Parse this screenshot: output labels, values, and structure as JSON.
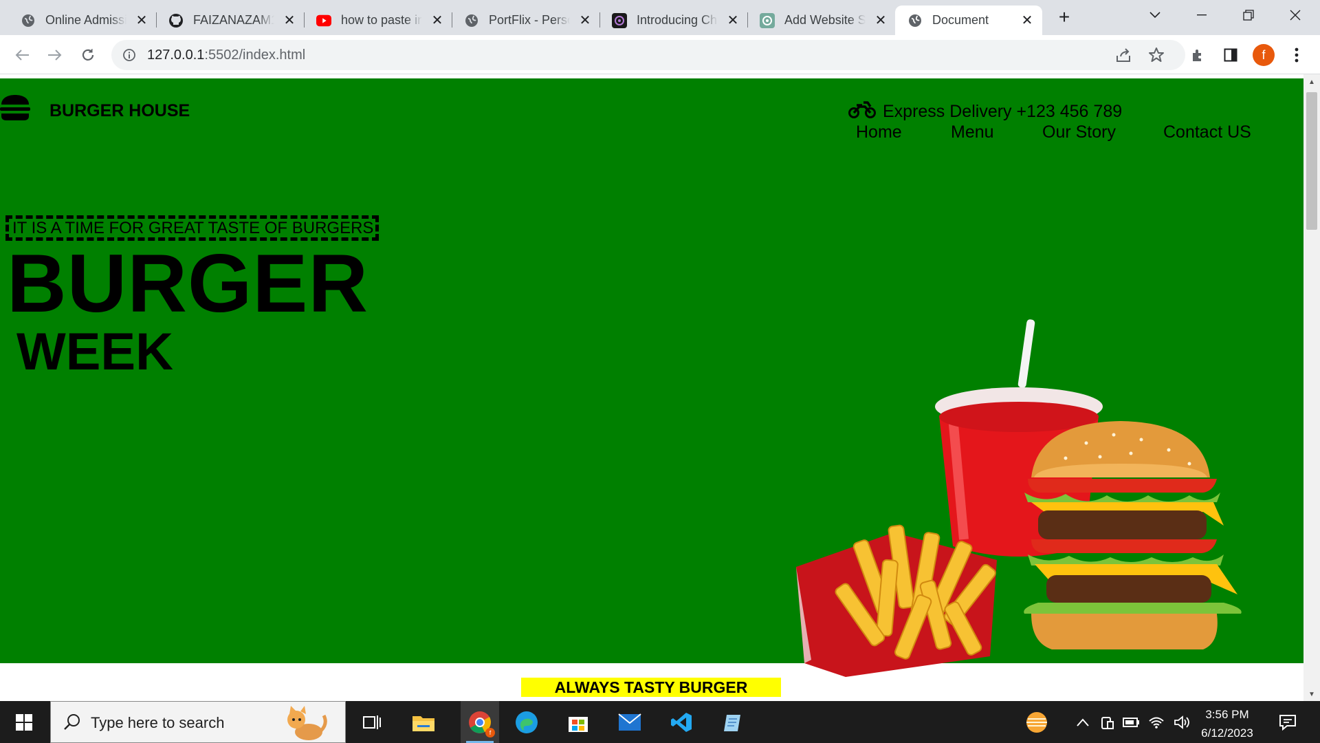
{
  "browser": {
    "tabs": [
      {
        "title": "Online Admissi",
        "icon": "globe-icon"
      },
      {
        "title": "FAIZANAZAM1",
        "icon": "github-icon"
      },
      {
        "title": "how to paste in",
        "icon": "youtube-icon"
      },
      {
        "title": "PortFlix - Perso",
        "icon": "globe-icon"
      },
      {
        "title": "Introducing Ch",
        "icon": "openai-icon"
      },
      {
        "title": "Add Website S",
        "icon": "openai-icon"
      },
      {
        "title": "Document",
        "icon": "globe-icon",
        "active": true
      }
    ],
    "url_host": "127.0.0.1",
    "url_rest": ":5502/index.html",
    "profile_initial": "f",
    "profile_color": "#e8590c"
  },
  "site": {
    "brand": "BURGER HOUSE",
    "delivery": "Express Delivery +123 456 789",
    "nav": [
      "Home",
      "Menu",
      "Our Story",
      "Contact US"
    ],
    "tagline": "IT IS A TIME FOR GREAT TASTE OF BURGERS",
    "headline": "BURGER",
    "subheadline": "WEEK",
    "section_label": "ALWAYS TASTY BURGER",
    "hero_color": "#008000",
    "label_color": "#ffff00"
  },
  "taskbar": {
    "search_placeholder": "Type here to search",
    "time": "3:56 PM",
    "date": "6/12/2023"
  }
}
